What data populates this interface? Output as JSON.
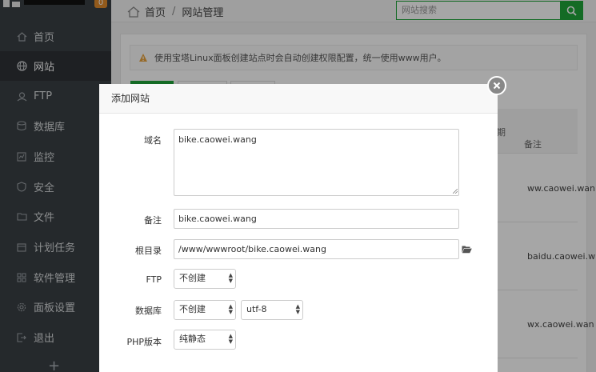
{
  "sidebar": {
    "badge": "0",
    "items": [
      {
        "label": "首页",
        "icon": "home-icon"
      },
      {
        "label": "网站",
        "icon": "globe-icon"
      },
      {
        "label": "FTP",
        "icon": "ftp-icon"
      },
      {
        "label": "数据库",
        "icon": "database-icon"
      },
      {
        "label": "监控",
        "icon": "monitor-icon"
      },
      {
        "label": "安全",
        "icon": "shield-icon"
      },
      {
        "label": "文件",
        "icon": "folder-icon"
      },
      {
        "label": "计划任务",
        "icon": "calendar-icon"
      },
      {
        "label": "软件管理",
        "icon": "grid-icon"
      },
      {
        "label": "面板设置",
        "icon": "gear-icon"
      },
      {
        "label": "退出",
        "icon": "logout-icon"
      }
    ],
    "plus": "+"
  },
  "header": {
    "crumb_home": "首页",
    "crumb_sep": "/",
    "crumb_current": "网站管理",
    "search_placeholder": "网站搜索"
  },
  "notice": "使用宝塔Linux面板创建站点时会自动创建权限配置，统一使用www用户。",
  "table": {
    "col_partial": "期",
    "col_remark": "备注",
    "rows": [
      "ww.caowei.wan",
      "baidu.caowei.w",
      "wx.caowei.wan"
    ]
  },
  "modal": {
    "title": "添加网站",
    "domain_label": "域名",
    "domain_value": "bike.caowei.wang",
    "remark_label": "备注",
    "remark_value": "bike.caowei.wang",
    "root_label": "根目录",
    "root_value": "/www/wwwroot/bike.caowei.wang",
    "ftp_label": "FTP",
    "ftp_value": "不创建",
    "db_label": "数据库",
    "db_value": "不创建",
    "charset_value": "utf-8",
    "php_label": "PHP版本",
    "php_value": "纯静态"
  },
  "colors": {
    "accent": "#20a53a",
    "sidebar": "#3a3f44"
  }
}
